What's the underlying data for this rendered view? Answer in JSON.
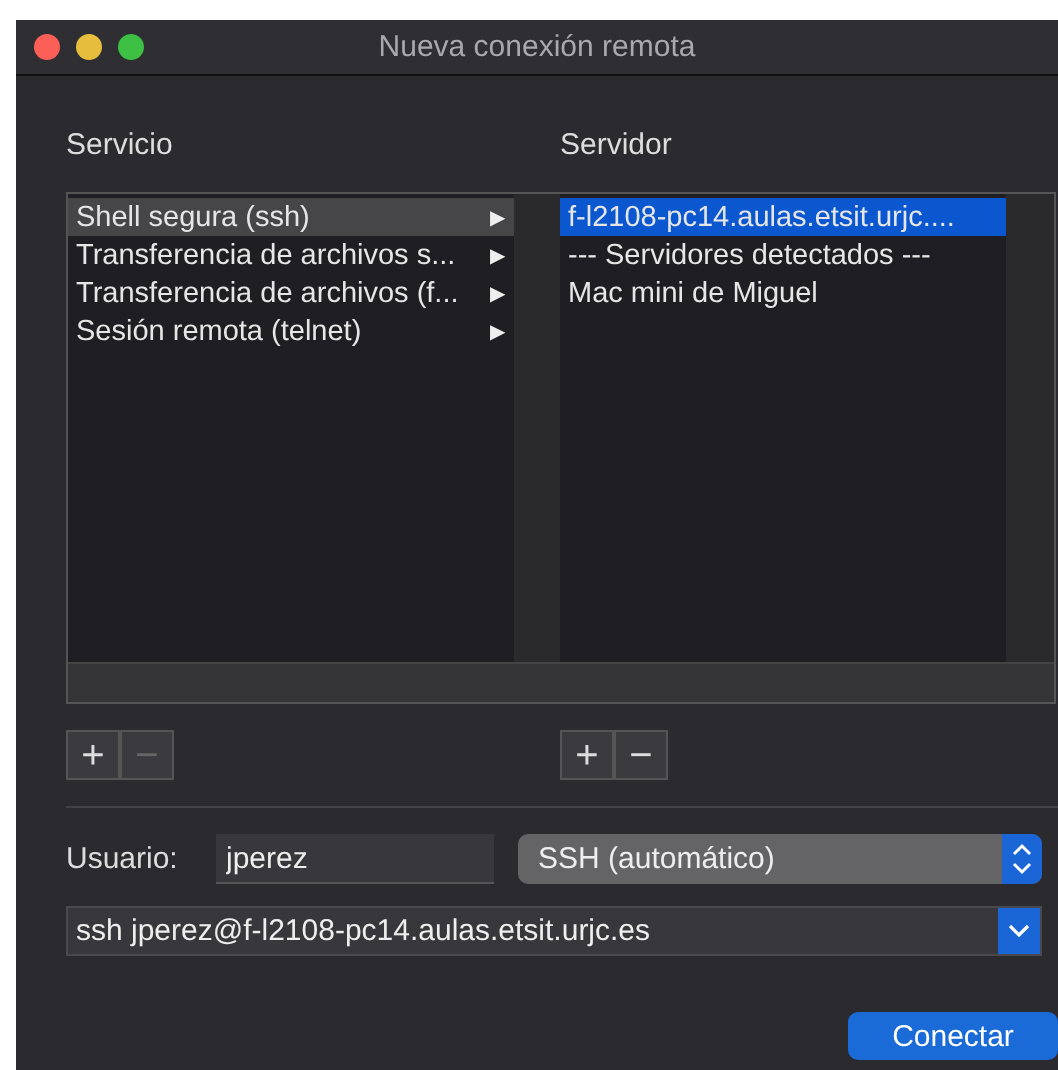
{
  "window": {
    "title": "Nueva conexión remota"
  },
  "services": {
    "heading": "Servicio",
    "items": [
      {
        "label": "Shell segura (ssh)",
        "arrow": "▶",
        "selected": true
      },
      {
        "label": "Transferencia de archivos s...",
        "arrow": "▶",
        "selected": false
      },
      {
        "label": "Transferencia de archivos (f...",
        "arrow": "▶",
        "selected": false
      },
      {
        "label": "Sesión remota (telnet)",
        "arrow": "▶",
        "selected": false
      }
    ],
    "buttons": [
      {
        "label": "+",
        "disabled": false
      },
      {
        "label": "−",
        "disabled": true
      }
    ]
  },
  "servers": {
    "heading": "Servidor",
    "items": [
      {
        "label": "f-l2108-pc14.aulas.etsit.urjc....",
        "selected": true
      },
      {
        "label": "--- Servidores detectados ---",
        "selected": false
      },
      {
        "label": "Mac mini de Miguel",
        "selected": false
      }
    ],
    "buttons": [
      {
        "label": "+",
        "disabled": false
      },
      {
        "label": "−",
        "disabled": false
      }
    ]
  },
  "user": {
    "label": "Usuario:",
    "value": "jperez"
  },
  "protocol": {
    "value": "SSH (automático)"
  },
  "command": {
    "value": "ssh jperez@f-l2108-pc14.aulas.etsit.urjc.es"
  },
  "connect_button": "Conectar"
}
